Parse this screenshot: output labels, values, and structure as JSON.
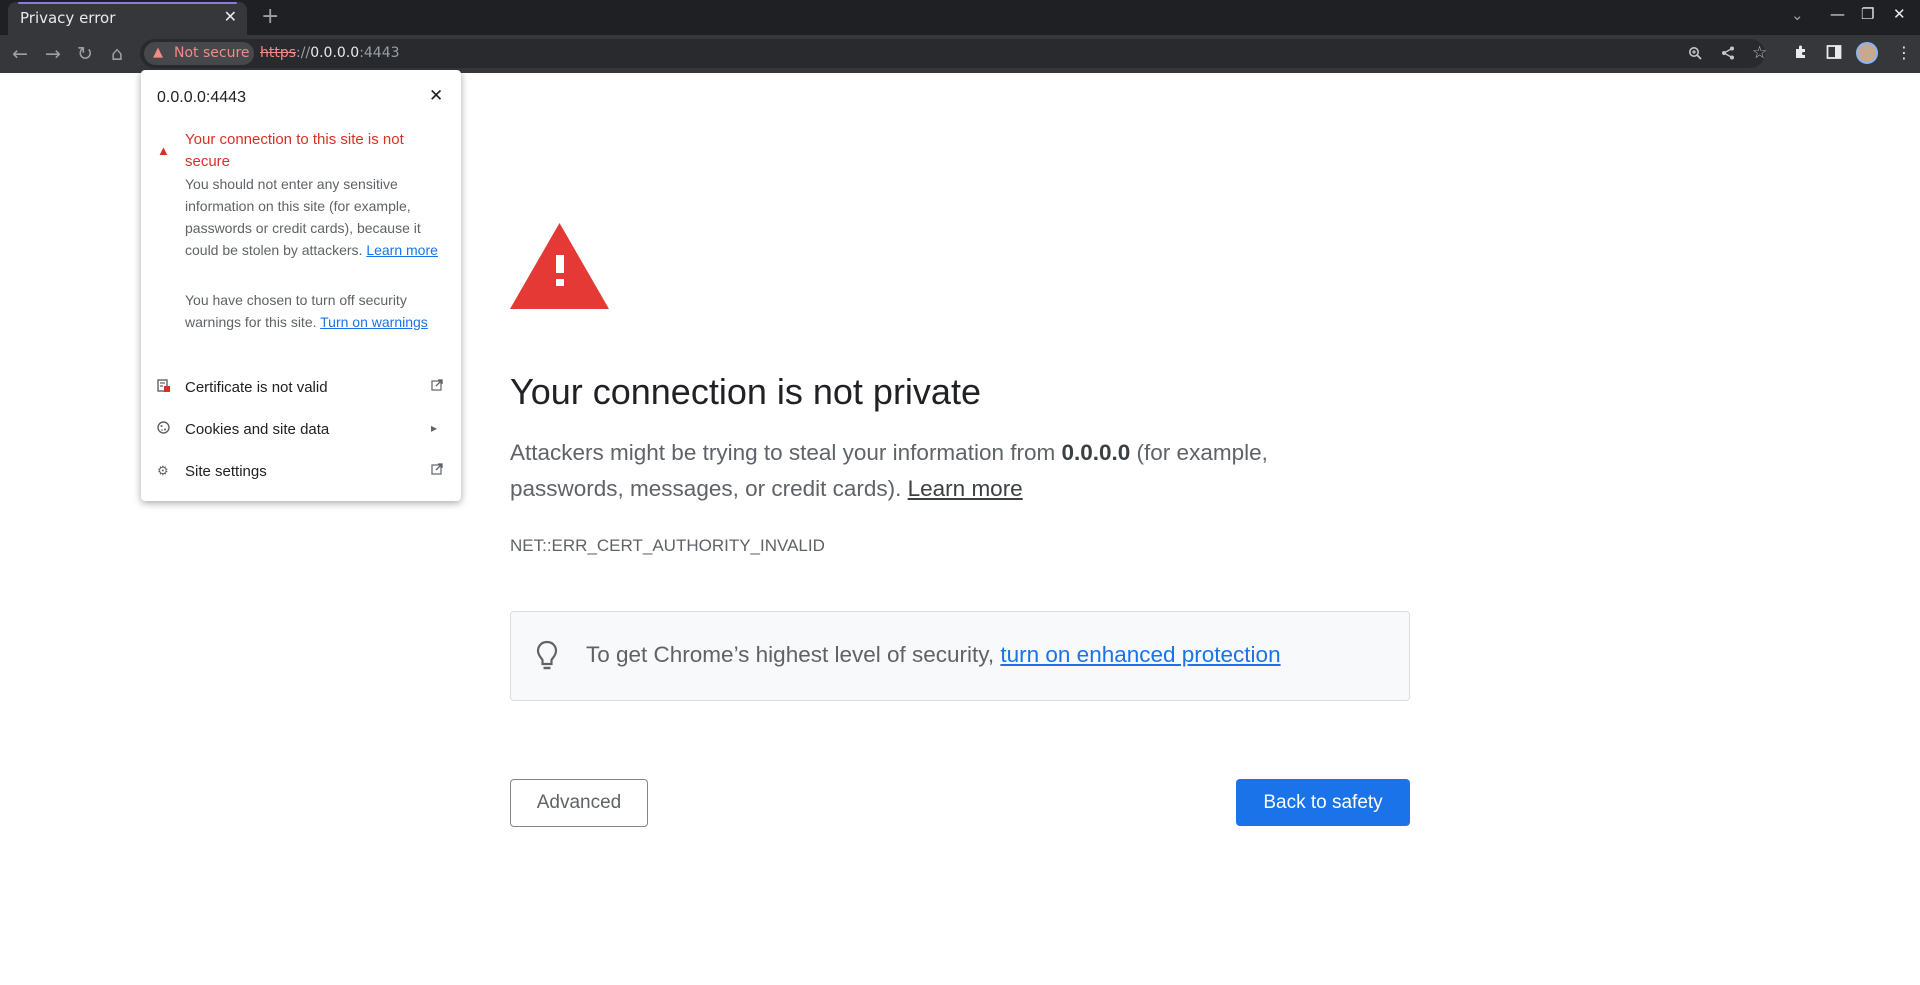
{
  "tab": {
    "title": "Privacy error",
    "close": "✕",
    "new_tab": "+"
  },
  "window": {
    "tab_search": "⌄",
    "minimize": "—",
    "restore": "❐",
    "close": "✕"
  },
  "toolbar": {
    "back": "←",
    "forward": "→",
    "reload": "↻",
    "home": "⌂",
    "security_chip": "Not secure",
    "url_scheme": "https",
    "url_sep": "://",
    "url_host": "0.0.0.0",
    "url_port": ":4443",
    "icons": [
      "zoom-icon",
      "share-icon",
      "bookmark-star-icon",
      "extensions-icon",
      "side-panel-icon",
      "profile-avatar",
      "more-menu-icon"
    ]
  },
  "popup": {
    "title": "0.0.0.0:4443",
    "security_title": "Your connection to this site is not secure",
    "security_body": "You should not enter any sensitive information on this site (for example, passwords or credit cards), because it could be stolen by attackers.",
    "learn_more": "Learn more",
    "warnings_body": "You have chosen to turn off security warnings for this site.",
    "turn_on_warnings": "Turn on warnings",
    "rows": [
      {
        "label": "Certificate is not valid",
        "icon": "certificate-icon",
        "trail": "external-link-icon"
      },
      {
        "label": "Cookies and site data",
        "icon": "cookie-icon",
        "trail": "chevron-right-icon"
      },
      {
        "label": "Site settings",
        "icon": "gear-icon",
        "trail": "external-link-icon"
      }
    ]
  },
  "interstitial": {
    "heading": "Your connection is not private",
    "desc_before": "Attackers might be trying to steal your information from ",
    "desc_host": "0.0.0.0",
    "desc_after": " (for example, passwords, messages, or credit cards). ",
    "learn_more": "Learn more",
    "error_code": "NET::ERR_CERT_AUTHORITY_INVALID",
    "enhanced_text": "To get Chrome’s highest level of security, ",
    "enhanced_link": "turn on enhanced protection",
    "advanced_button": "Advanced",
    "back_button": "Back to safety"
  },
  "colors": {
    "danger": "#d93025",
    "link": "#1a73e8",
    "primary_button": "#1a73e8",
    "warning_triangle": "#d93025"
  }
}
